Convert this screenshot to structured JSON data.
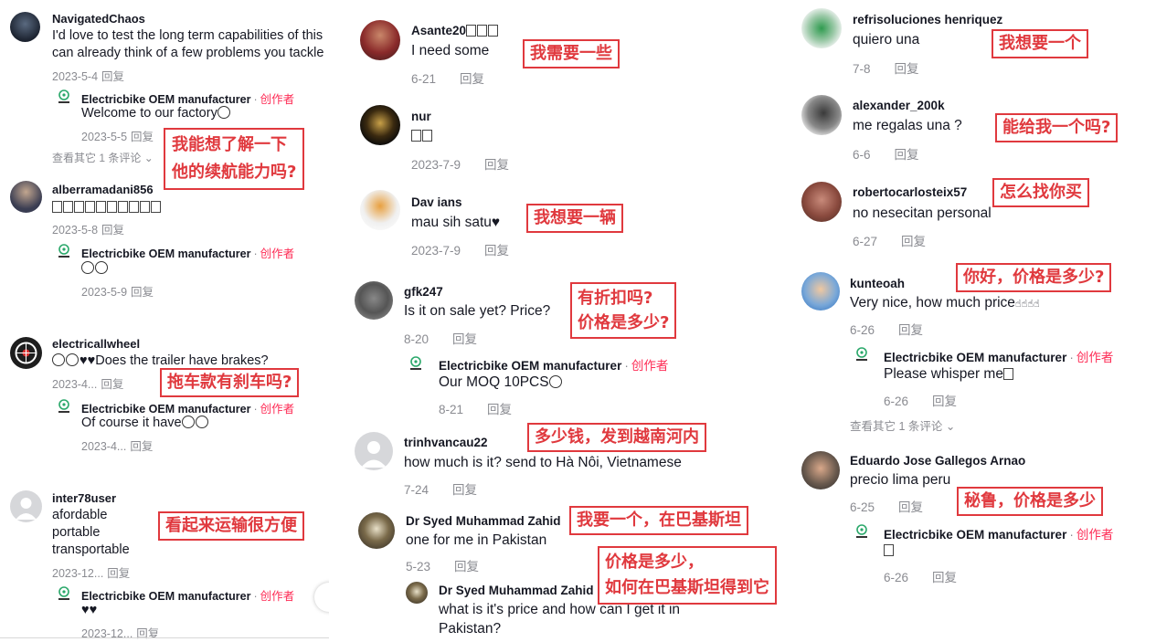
{
  "colors": {
    "accent": "#fe2c55",
    "annotation": "#e0393e",
    "meta": "#8a8b91"
  },
  "creator_label": "创作者",
  "reply_label": "回复",
  "oem_name": "Electricbike OEM manufacturer",
  "col1": {
    "c1": {
      "user": "NavigatedChaos",
      "text1": "I'd love to test the long term capabilities of this",
      "text2": "can already think of a few problems you tackle",
      "date": "2023-5-4",
      "reply": {
        "text": "Welcome to our factory",
        "date": "2023-5-5"
      },
      "more": "查看其它 1 条评论",
      "note1": "我能想了解一下",
      "note2": "他的续航能力吗?"
    },
    "c2": {
      "user": "alberramadani856",
      "date": "2023-5-8",
      "reply": {
        "date": "2023-5-9"
      }
    },
    "c3": {
      "user": "electricallwheel",
      "text": "Does the trailer have brakes?",
      "date": "2023-4...",
      "reply": {
        "text": "Of course it have",
        "date": "2023-4..."
      },
      "note": "拖车款有刹车吗?"
    },
    "c4": {
      "user": "inter78user",
      "line1": "afordable",
      "line2": "portable",
      "line3": "transportable",
      "date": "2023-12...",
      "reply": {
        "date": "2023-12..."
      },
      "note": "看起来运输很方便"
    }
  },
  "col2": {
    "c1": {
      "user": "Asante20",
      "text": "I need some",
      "date": "6-21",
      "note": "我需要一些"
    },
    "c2": {
      "user": "nur",
      "date": "2023-7-9"
    },
    "c3": {
      "user": "Dav ians",
      "text": "mau sih satu",
      "date": "2023-7-9",
      "note": "我想要一辆"
    },
    "c4": {
      "user": "gfk247",
      "text": "Is it on sale yet? Price?",
      "date": "8-20",
      "reply": {
        "text": "Our MOQ 10PCS",
        "date": "8-21"
      },
      "note1": "有折扣吗?",
      "note2": "价格是多少?"
    },
    "c5": {
      "user": "trinhvancau22",
      "text": "how much is it? send to Hà Nôi, Vietnamese",
      "date": "7-24",
      "note": "多少钱，发到越南河内"
    },
    "c6": {
      "user": "Dr Syed Muhammad Zahid",
      "text": "one for me in Pakistan",
      "date": "5-23",
      "note": "我要一个，在巴基斯坦",
      "reply": {
        "user": "Dr Syed Muhammad Zahid",
        "text1": "what is it's price and how can I get it in",
        "text2": "Pakistan?"
      },
      "note2a": "价格是多少，",
      "note2b": "如何在巴基斯坦得到它"
    }
  },
  "col3": {
    "c1": {
      "user": "refrisoluciones henriquez",
      "text": "quiero una",
      "date": "7-8",
      "note": "我想要一个"
    },
    "c2": {
      "user": "alexander_200k",
      "text": "me regalas una ?",
      "date": "6-6",
      "note": "能给我一个吗?"
    },
    "c3": {
      "user": "robertocarlosteix57",
      "text": "no nesecitan personal",
      "date": "6-27",
      "note": "怎么找你买"
    },
    "c4": {
      "user": "kunteoah",
      "text": "Very nice, how much price",
      "date": "6-26",
      "note": "你好，价格是多少?",
      "reply": {
        "text": "Please whisper me",
        "date": "6-26"
      },
      "more": "查看其它 1 条评论"
    },
    "c5": {
      "user": "Eduardo Jose Gallegos Arnao",
      "text": "precio lima peru",
      "date": "6-25",
      "note": "秘鲁，价格是多少",
      "reply": {
        "date": "6-26"
      }
    }
  }
}
